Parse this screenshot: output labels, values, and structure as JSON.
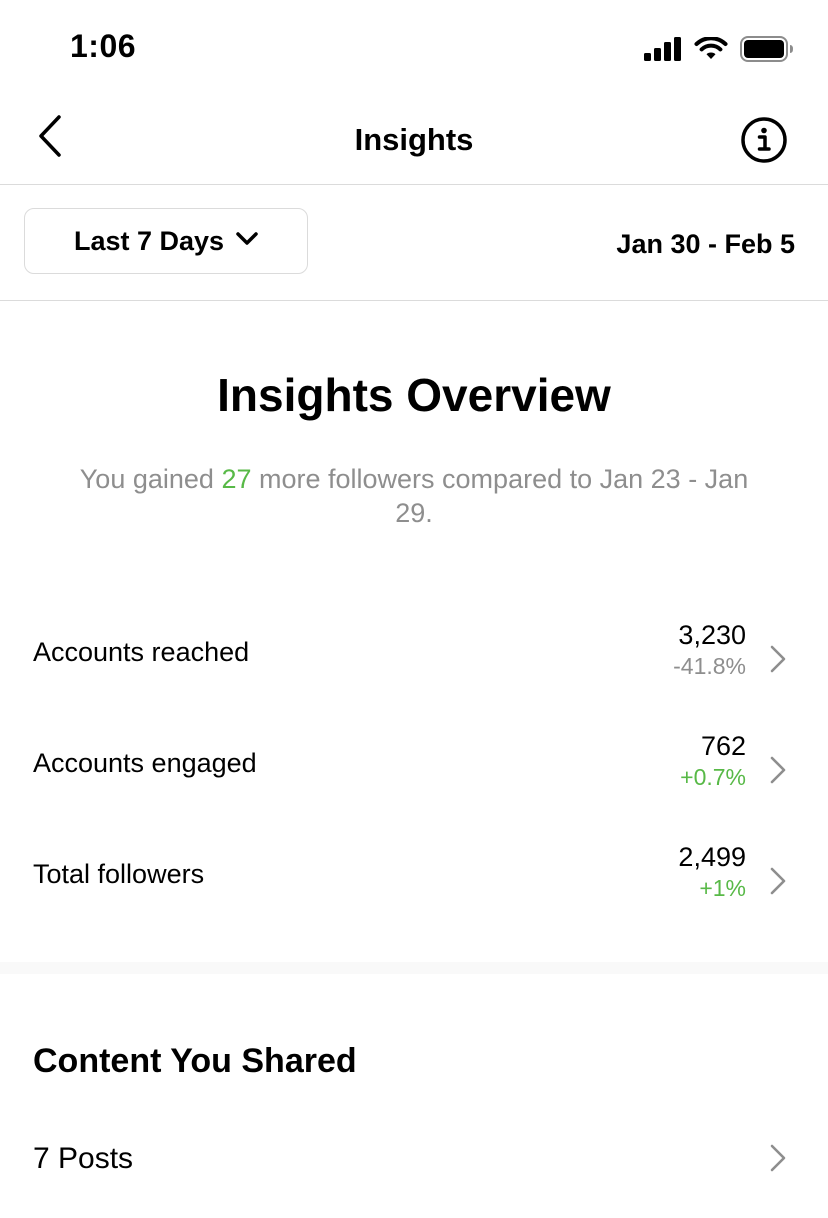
{
  "status_bar": {
    "time": "1:06",
    "icons": [
      "cellular-signal-icon",
      "wifi-icon",
      "battery-icon"
    ]
  },
  "nav": {
    "title": "Insights",
    "back_icon": "chevron-left-icon",
    "info_icon": "info-icon"
  },
  "filter": {
    "period_label": "Last 7 Days",
    "period_icon": "chevron-down-icon",
    "date_range": "Jan 30 - Feb 5"
  },
  "overview": {
    "title": "Insights Overview",
    "subtitle_prefix": "You gained ",
    "gain_value": "27",
    "subtitle_suffix": " more followers compared to Jan 23 - Jan 29."
  },
  "metrics": [
    {
      "label": "Accounts reached",
      "value": "3,230",
      "change": "-41.8%",
      "trend": "negative"
    },
    {
      "label": "Accounts engaged",
      "value": "762",
      "change": "+0.7%",
      "trend": "positive"
    },
    {
      "label": "Total followers",
      "value": "2,499",
      "change": "+1%",
      "trend": "positive"
    }
  ],
  "content": {
    "title": "Content You Shared",
    "posts_label": "7 Posts"
  },
  "colors": {
    "positive": "#58b947",
    "muted": "#8e8e8e",
    "divider": "#dbdbdb"
  }
}
